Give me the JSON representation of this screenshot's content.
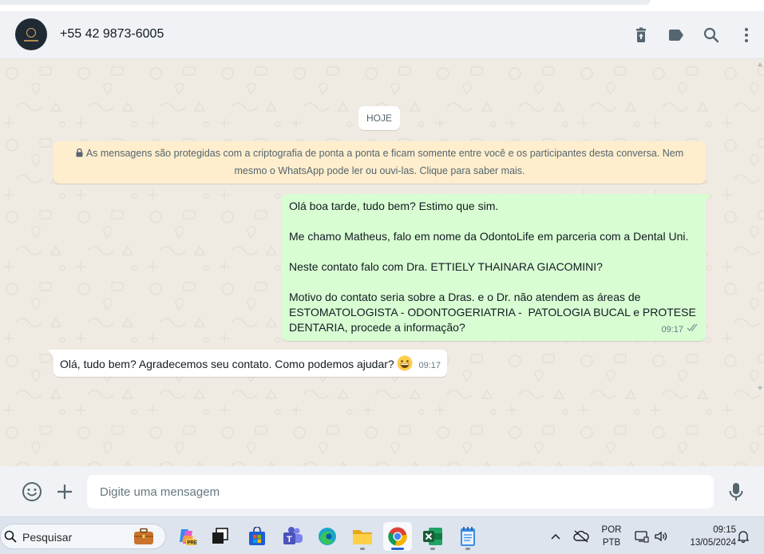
{
  "contact": {
    "name": "+55 42 9873-6005"
  },
  "header_icons": [
    "delete-icon",
    "label-icon",
    "search-icon",
    "menu-icon"
  ],
  "chat": {
    "day_label": "HOJE",
    "encryption_notice": "As mensagens são protegidas com a criptografia de ponta a ponta e ficam somente entre você e os participantes desta conversa. Nem mesmo o WhatsApp pode ler ou ouvi-las. Clique para saber mais.",
    "messages": [
      {
        "direction": "outgoing",
        "lines": [
          "Olá boa tarde, tudo bem? Estimo que sim.",
          "",
          "Me chamo Matheus, falo em nome da OdontoLife em parceria com a Dental Uni.",
          "",
          "Neste contato falo com Dra. ETTIELY THAINARA GIACOMINI?",
          "",
          "Motivo do contato seria sobre a Dras. e o Dr. não atendem as áreas de",
          "ESTOMATOLOGISTA - ODONTOGERIATRIA -  PATOLOGIA BUCAL e PROTESE",
          "DENTARIA, procede a informação?"
        ],
        "time": "09:17",
        "status": "read"
      },
      {
        "direction": "incoming",
        "text": "Olá, tudo bem? Agradecemos seu contato. Como podemos ajudar?",
        "emoji": "grinning-face",
        "time": "09:17"
      }
    ]
  },
  "composer": {
    "placeholder": "Digite uma mensagem"
  },
  "taskbar": {
    "search_label": "Pesquisar",
    "apps": [
      "copilot",
      "task-view",
      "microsoft-store",
      "teams",
      "edge",
      "file-explorer",
      "chrome",
      "excel",
      "notepad"
    ],
    "active_app": "chrome",
    "language_top": "POR",
    "language_bottom": "PTB",
    "time": "09:15",
    "date": "13/05/2024"
  },
  "colors": {
    "chat_bg": "#efeae2",
    "outgoing_bubble": "#d9fdd3",
    "incoming_bubble": "#ffffff",
    "notice_bg": "#ffeecd",
    "icon_gray": "#54656f",
    "read_tick": "#8696a0"
  }
}
